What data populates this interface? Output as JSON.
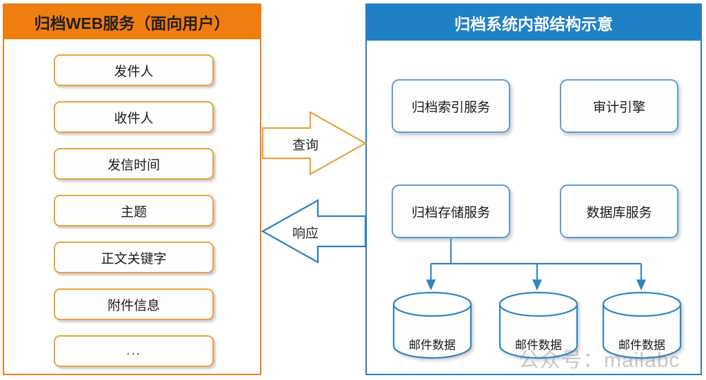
{
  "left_panel": {
    "title": "归档WEB服务（面向用户）",
    "accent_color": "#F07D0F",
    "border_color": "#ED7D1B",
    "items": [
      {
        "label": "发件人"
      },
      {
        "label": "收件人"
      },
      {
        "label": "发信时间"
      },
      {
        "label": "主题"
      },
      {
        "label": "正文关键字"
      },
      {
        "label": "附件信息"
      },
      {
        "label": "..."
      }
    ]
  },
  "right_panel": {
    "title": "归档系统内部结构示意",
    "accent_color": "#2080C6",
    "border_color": "#2B7DBF",
    "services": [
      {
        "label": "归档索引服务"
      },
      {
        "label": "审计引擎"
      },
      {
        "label": "归档存储服务"
      },
      {
        "label": "数据库服务"
      }
    ],
    "datastores": [
      {
        "label": "邮件数据"
      },
      {
        "label": "邮件数据"
      },
      {
        "label": "邮件数据"
      }
    ]
  },
  "flows": {
    "query": {
      "label": "查询",
      "color": "#E8A33D",
      "direction": "right"
    },
    "response": {
      "label": "响应",
      "color": "#2B7DBF",
      "direction": "left"
    }
  },
  "watermark": {
    "text": "公众号：mailabc"
  }
}
